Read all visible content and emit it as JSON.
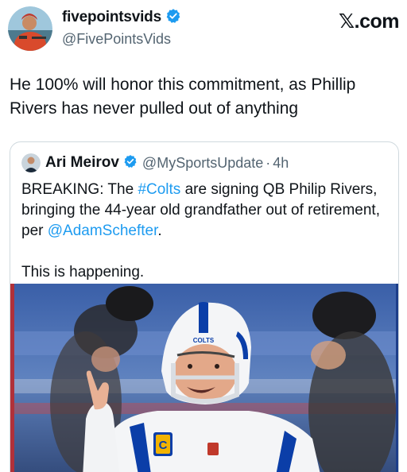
{
  "header": {
    "display_name": "fivepointsvids",
    "handle": "@FivePointsVids",
    "brand": "𝕏.com",
    "avatar_icon": "profile-avatar",
    "verified_icon": "verified-badge-icon"
  },
  "tweet": {
    "text": "He 100% will honor this commitment, as Phillip Rivers has never pulled out of anything"
  },
  "quote": {
    "display_name": "Ari Meirov",
    "handle": "@MySportsUpdate",
    "separator": "·",
    "time": "4h",
    "text_part1": "BREAKING: The ",
    "hashtag": "#Colts",
    "text_part2": " are signing QB Philip Rivers, bringing the 44-year old grandfather out of retirement, per ",
    "mention": "@AdamSchefter",
    "text_part3": ".",
    "text_line2": "This is happening.",
    "image_helmet_text": "COLTS",
    "image_patch_text": "C"
  },
  "colors": {
    "accent": "#1d9bf0",
    "secondary_text": "#536471",
    "colts_blue": "#0b3ea8"
  }
}
